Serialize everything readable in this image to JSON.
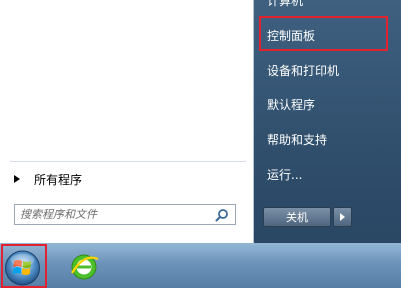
{
  "start_menu": {
    "left_pane": {
      "all_programs_label": "所有程序",
      "search_placeholder": "搜索程序和文件"
    },
    "right_pane": {
      "items": [
        {
          "label": "计算机"
        },
        {
          "label": "控制面板"
        },
        {
          "label": "设备和打印机"
        },
        {
          "label": "默认程序"
        },
        {
          "label": "帮助和支持"
        },
        {
          "label": "运行..."
        }
      ],
      "shutdown_label": "关机"
    }
  },
  "colors": {
    "highlight_box": "#e0232f",
    "right_pane": "#2f4f6d",
    "taskbar": "#6c93b9"
  },
  "icons": {
    "search": "search-icon",
    "start": "windows-start-orb-icon",
    "browser": "ie-browser-icon"
  }
}
